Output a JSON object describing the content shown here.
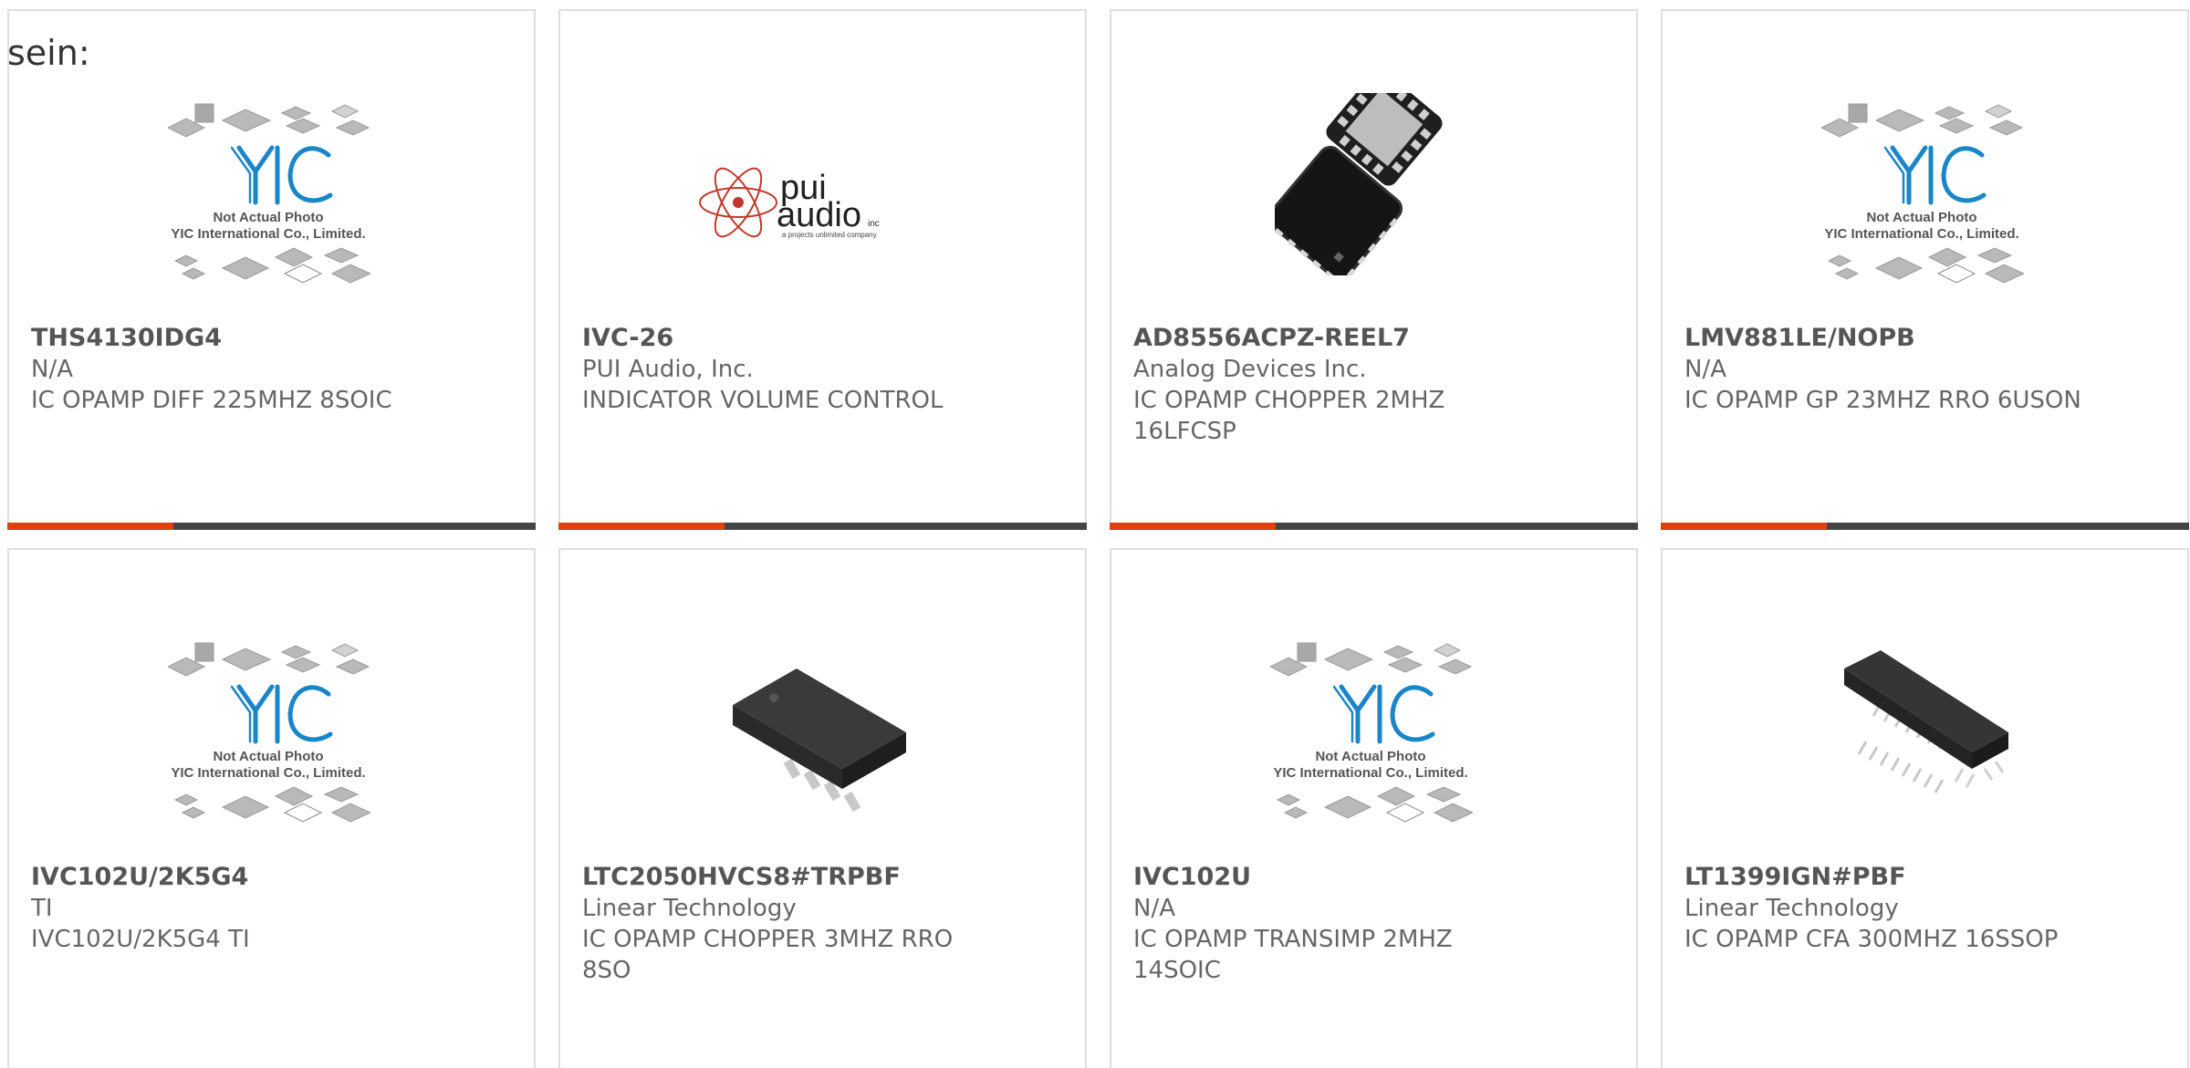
{
  "intro_text": "sein:",
  "colors": {
    "accent": "#e0400e",
    "bar": "#444444",
    "border": "#dedede",
    "yic_blue": "#1a86c8"
  },
  "placeholder_logo": {
    "brand": "YIC",
    "line1": "Not Actual Photo",
    "line2": "YIC International Co., Limited."
  },
  "pui_logo": {
    "word1": "pui",
    "word2": "audio",
    "suffix": "inc",
    "tagline": "a projects unlimited company"
  },
  "products": [
    {
      "part_number": "THS4130IDG4",
      "manufacturer": "N/A",
      "description": "IC OPAMP DIFF 225MHZ 8SOIC",
      "image": "yic-placeholder"
    },
    {
      "part_number": "IVC-26",
      "manufacturer": "PUI Audio, Inc.",
      "description": "INDICATOR VOLUME CONTROL",
      "image": "pui-audio-logo"
    },
    {
      "part_number": "AD8556ACPZ-REEL7",
      "manufacturer": "Analog Devices Inc.",
      "description": "IC OPAMP CHOPPER 2MHZ 16LFCSP",
      "image": "lfcsp-chip"
    },
    {
      "part_number": "LMV881LE/NOPB",
      "manufacturer": "N/A",
      "description": "IC OPAMP GP 23MHZ RRO 6USON",
      "image": "yic-placeholder"
    },
    {
      "part_number": "IVC102U/2K5G4",
      "manufacturer": "TI",
      "description": "IVC102U/2K5G4 TI",
      "image": "yic-placeholder"
    },
    {
      "part_number": "LTC2050HVCS8#TRPBF",
      "manufacturer": "Linear Technology",
      "description": "IC OPAMP CHOPPER 3MHZ RRO 8SO",
      "image": "so8-chip"
    },
    {
      "part_number": "IVC102U",
      "manufacturer": "N/A",
      "description": "IC OPAMP TRANSIMP 2MHZ 14SOIC",
      "image": "yic-placeholder"
    },
    {
      "part_number": "LT1399IGN#PBF",
      "manufacturer": "Linear Technology",
      "description": "IC OPAMP CFA 300MHZ 16SSOP",
      "image": "ssop-chip"
    }
  ]
}
